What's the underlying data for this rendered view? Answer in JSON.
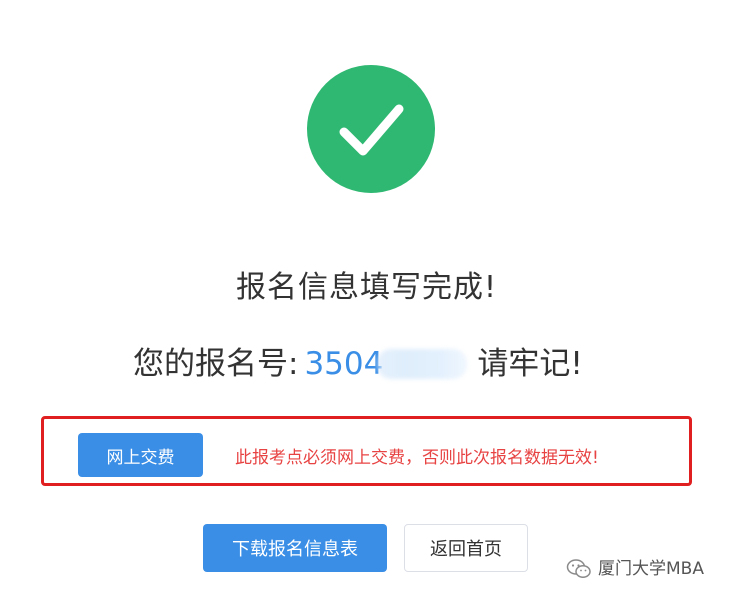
{
  "status": {
    "icon": "check-circle-icon",
    "color": "#2fb872",
    "headline": "报名信息填写完成!"
  },
  "registration": {
    "label": "您的报名号:",
    "number_visible": "3504",
    "suffix": "请牢记!"
  },
  "payment_notice": {
    "pay_button_label": "网上交费",
    "warning_text": "此报考点必须网上交费，否则此次报名数据无效!",
    "border_color": "#e02020",
    "text_color": "#e84343"
  },
  "actions": {
    "download_label": "下载报名信息表",
    "home_label": "返回首页"
  },
  "watermark": {
    "icon": "wechat-icon",
    "text": "厦门大学MBA"
  },
  "colors": {
    "primary": "#3a8ee6"
  }
}
